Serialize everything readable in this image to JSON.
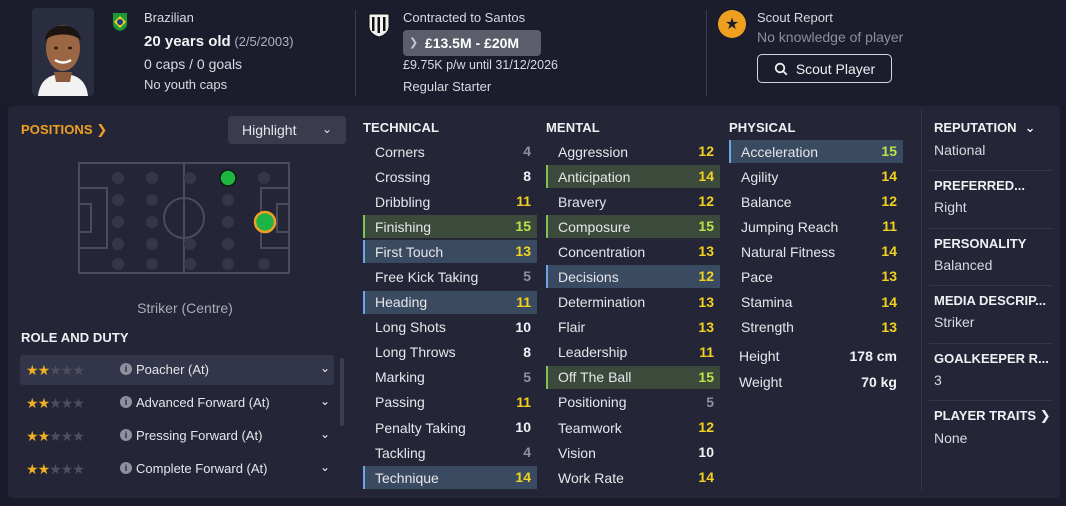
{
  "header": {
    "nationality": "Brazilian",
    "age": "20 years old",
    "dob": "(2/5/2003)",
    "caps_goals": "0 caps / 0 goals",
    "youth_caps": "No youth caps",
    "contract": "Contracted to Santos",
    "value_range": "£13.5M - £20M",
    "wage": "£9.75K p/w until 31/12/2026",
    "squad_status": "Regular Starter",
    "scout_title": "Scout Report",
    "scout_subtitle": "No knowledge of player",
    "scout_button": "Scout Player"
  },
  "positions": {
    "title": "POSITIONS",
    "highlight_label": "Highlight",
    "position_name": "Striker (Centre)"
  },
  "role_duty": {
    "title": "ROLE AND DUTY",
    "roles": [
      {
        "name": "Poacher (At)",
        "stars": 2,
        "selected": true
      },
      {
        "name": "Advanced Forward (At)",
        "stars": 2,
        "selected": false
      },
      {
        "name": "Pressing Forward (At)",
        "stars": 2,
        "selected": false
      },
      {
        "name": "Complete Forward (At)",
        "stars": 2,
        "selected": false
      }
    ]
  },
  "technical": {
    "title": "TECHNICAL",
    "attributes": [
      {
        "name": "Corners",
        "value": "4",
        "hl": ""
      },
      {
        "name": "Crossing",
        "value": "8",
        "hl": ""
      },
      {
        "name": "Dribbling",
        "value": "11",
        "hl": ""
      },
      {
        "name": "Finishing",
        "value": "15",
        "hl": "green"
      },
      {
        "name": "First Touch",
        "value": "13",
        "hl": "blue"
      },
      {
        "name": "Free Kick Taking",
        "value": "5",
        "hl": ""
      },
      {
        "name": "Heading",
        "value": "11",
        "hl": "blue"
      },
      {
        "name": "Long Shots",
        "value": "10",
        "hl": ""
      },
      {
        "name": "Long Throws",
        "value": "8",
        "hl": ""
      },
      {
        "name": "Marking",
        "value": "5",
        "hl": ""
      },
      {
        "name": "Passing",
        "value": "11",
        "hl": ""
      },
      {
        "name": "Penalty Taking",
        "value": "10",
        "hl": ""
      },
      {
        "name": "Tackling",
        "value": "4",
        "hl": ""
      },
      {
        "name": "Technique",
        "value": "14",
        "hl": "blue"
      }
    ]
  },
  "mental": {
    "title": "MENTAL",
    "attributes": [
      {
        "name": "Aggression",
        "value": "12",
        "hl": ""
      },
      {
        "name": "Anticipation",
        "value": "14",
        "hl": "green"
      },
      {
        "name": "Bravery",
        "value": "12",
        "hl": ""
      },
      {
        "name": "Composure",
        "value": "15",
        "hl": "green"
      },
      {
        "name": "Concentration",
        "value": "13",
        "hl": ""
      },
      {
        "name": "Decisions",
        "value": "12",
        "hl": "blue"
      },
      {
        "name": "Determination",
        "value": "13",
        "hl": ""
      },
      {
        "name": "Flair",
        "value": "13",
        "hl": ""
      },
      {
        "name": "Leadership",
        "value": "11",
        "hl": ""
      },
      {
        "name": "Off The Ball",
        "value": "15",
        "hl": "green"
      },
      {
        "name": "Positioning",
        "value": "5",
        "hl": ""
      },
      {
        "name": "Teamwork",
        "value": "12",
        "hl": ""
      },
      {
        "name": "Vision",
        "value": "10",
        "hl": ""
      },
      {
        "name": "Work Rate",
        "value": "14",
        "hl": ""
      }
    ]
  },
  "physical": {
    "title": "PHYSICAL",
    "attributes": [
      {
        "name": "Acceleration",
        "value": "15",
        "hl": "blue"
      },
      {
        "name": "Agility",
        "value": "14",
        "hl": ""
      },
      {
        "name": "Balance",
        "value": "12",
        "hl": ""
      },
      {
        "name": "Jumping Reach",
        "value": "11",
        "hl": ""
      },
      {
        "name": "Natural Fitness",
        "value": "14",
        "hl": ""
      },
      {
        "name": "Pace",
        "value": "13",
        "hl": ""
      },
      {
        "name": "Stamina",
        "value": "14",
        "hl": ""
      },
      {
        "name": "Strength",
        "value": "13",
        "hl": ""
      }
    ],
    "height_label": "Height",
    "height_value": "178 cm",
    "weight_label": "Weight",
    "weight_value": "70 kg"
  },
  "info": {
    "reputation_label": "REPUTATION",
    "reputation_value": "National",
    "preferred_label": "PREFERRED...",
    "preferred_value": "Right",
    "personality_label": "PERSONALITY",
    "personality_value": "Balanced",
    "media_label": "MEDIA DESCRIP...",
    "media_value": "Striker",
    "gk_label": "GOALKEEPER R...",
    "gk_value": "3",
    "traits_label": "PLAYER TRAITS",
    "traits_value": "None"
  },
  "colors": {
    "accent": "#f0a020",
    "highlight_green": "#3c4a3c",
    "highlight_blue": "#3a4a60",
    "value_gray": "#8f919e",
    "value_white": "#f2f2f5",
    "value_yellow": "#f2d21e",
    "value_lime": "#b9e34a",
    "value_green": "#5fe03a"
  }
}
